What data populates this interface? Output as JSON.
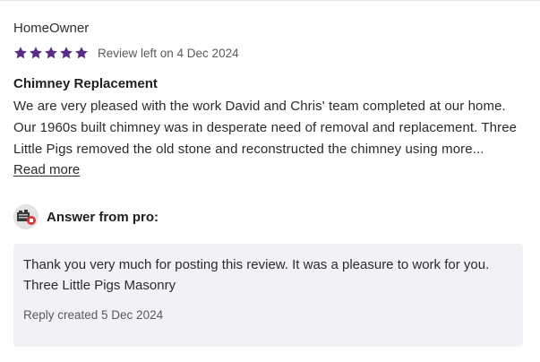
{
  "review": {
    "author": "HomeOwner",
    "rating": 5,
    "rating_max": 5,
    "star_color": "#5b2a86",
    "date": "Review left on 4 Dec 2024",
    "title": "Chimney Replacement",
    "body_lines": [
      "We are very pleased with the work David and Chris' team completed at our home.",
      "Our 1960s built chimney was in desperate need of removal and replacement. Three",
      "Little Pigs removed the old stone and reconstructed the chimney using more..."
    ],
    "read_more": "Read more"
  },
  "pro": {
    "label": "Answer from pro:",
    "avatar_icon": "company-logo-avatar",
    "reply_lines": [
      "Thank you very much for posting this review. It was a pleasure to work for you.",
      "Three Little Pigs Masonry"
    ],
    "reply_date": "Reply created 5 Dec 2024"
  }
}
